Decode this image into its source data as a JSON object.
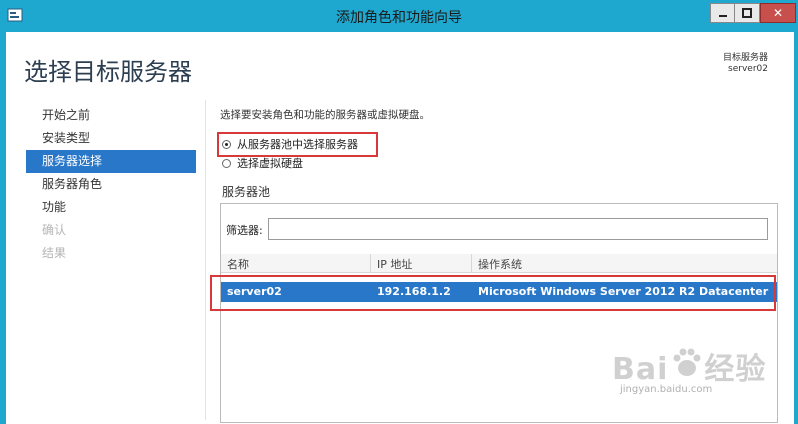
{
  "window": {
    "title": "添加角色和功能向导",
    "close_symbol": "✕"
  },
  "header": {
    "page_title": "选择目标服务器",
    "destination_label": "目标服务器",
    "destination_server": "server02"
  },
  "nav": {
    "items": [
      {
        "label": "开始之前",
        "state": "normal"
      },
      {
        "label": "安装类型",
        "state": "normal"
      },
      {
        "label": "服务器选择",
        "state": "selected"
      },
      {
        "label": "服务器角色",
        "state": "normal"
      },
      {
        "label": "功能",
        "state": "normal"
      },
      {
        "label": "确认",
        "state": "disabled"
      },
      {
        "label": "结果",
        "state": "disabled"
      }
    ]
  },
  "main": {
    "instruction": "选择要安装角色和功能的服务器或虚拟硬盘。",
    "option_pool": "从服务器池中选择服务器",
    "option_vhd": "选择虚拟硬盘",
    "pool_label": "服务器池",
    "filter_label": "筛选器:",
    "filter_value": "",
    "columns": [
      "名称",
      "IP 地址",
      "操作系统"
    ],
    "rows": [
      {
        "name": "server02",
        "ip": "192.168.1.2",
        "os": "Microsoft Windows Server 2012 R2 Datacenter"
      }
    ]
  },
  "watermark": {
    "brand_left": "Bai",
    "brand_right": "经验",
    "site": "jingyan.baidu.com"
  },
  "colors": {
    "titlebar": "#1fa8cf",
    "selection": "#2877c9",
    "highlight_box": "#d9383a",
    "close_button": "#c7504d"
  }
}
